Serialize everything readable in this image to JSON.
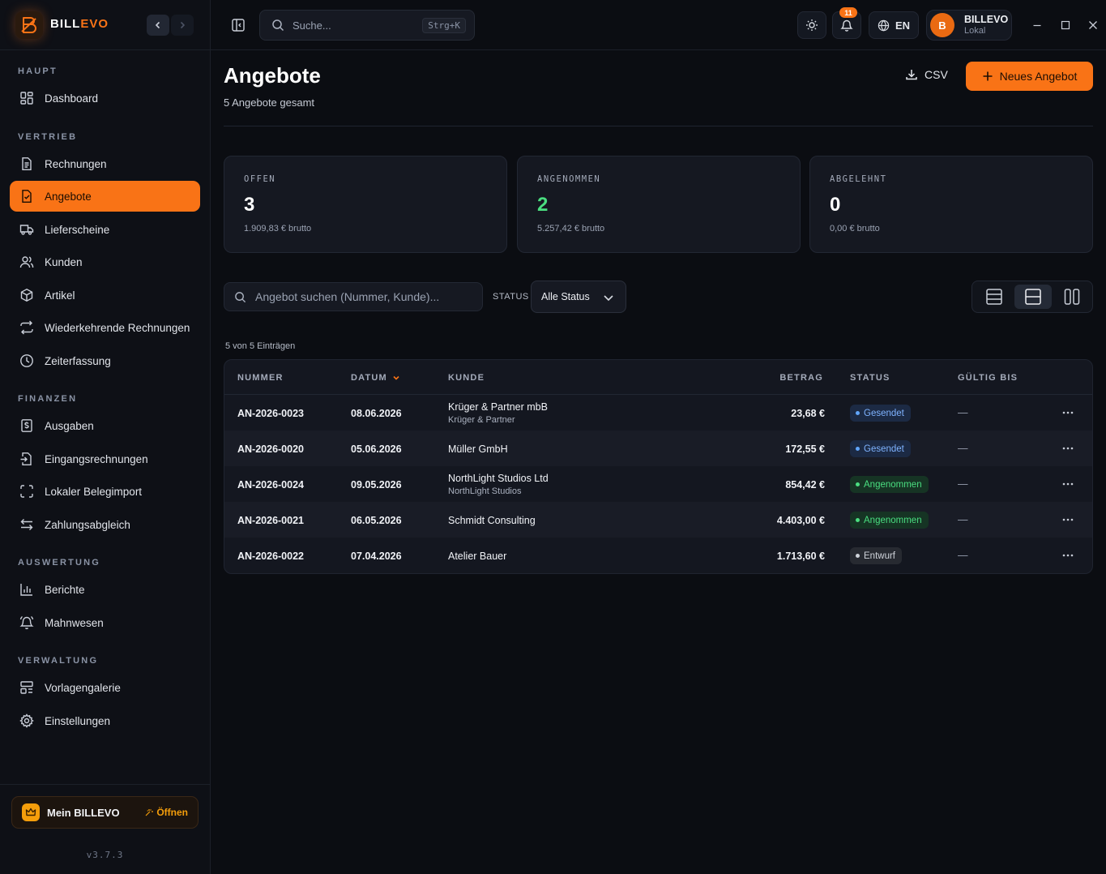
{
  "brand": {
    "part1": "BILL",
    "part2": "EVO",
    "version": "v3.7.3"
  },
  "colors": {
    "accent": "#f97316",
    "sent": "#60a5fa",
    "accepted": "#4ade80",
    "draft": "#cfd3da"
  },
  "sidebar": {
    "sections": {
      "haupt": "HAUPT",
      "vertrieb": "VERTRIEB",
      "finanzen": "FINANZEN",
      "auswertung": "AUSWERTUNG",
      "verwaltung": "VERWALTUNG"
    },
    "items": [
      {
        "label": "Dashboard",
        "icon": "dashboard-icon"
      },
      {
        "label": "Rechnungen",
        "icon": "invoice-icon"
      },
      {
        "label": "Angebote",
        "icon": "quote-icon",
        "active": true
      },
      {
        "label": "Lieferscheine",
        "icon": "truck-icon"
      },
      {
        "label": "Kunden",
        "icon": "users-icon"
      },
      {
        "label": "Artikel",
        "icon": "box-icon"
      },
      {
        "label": "Wiederkehrende Rechnungen",
        "icon": "repeat-icon"
      },
      {
        "label": "Zeiterfassung",
        "icon": "clock-icon"
      },
      {
        "label": "Ausgaben",
        "icon": "receipt-icon"
      },
      {
        "label": "Eingangsrechnungen",
        "icon": "file-import-icon"
      },
      {
        "label": "Lokaler Belegimport",
        "icon": "scan-icon"
      },
      {
        "label": "Zahlungsabgleich",
        "icon": "arrows-swap-icon"
      },
      {
        "label": "Berichte",
        "icon": "bar-chart-icon"
      },
      {
        "label": "Mahnwesen",
        "icon": "bell-ring-icon"
      },
      {
        "label": "Vorlagengalerie",
        "icon": "template-icon"
      },
      {
        "label": "Einstellungen",
        "icon": "gear-icon"
      }
    ],
    "mein": {
      "label": "Mein BILLEVO",
      "open": "Öffnen"
    }
  },
  "topbar": {
    "search_placeholder": "Suche...",
    "shortcut": "Strg+K",
    "notifications": "11",
    "language": "EN",
    "user": {
      "initial": "B",
      "name": "BILLEVO",
      "sub": "Lokal"
    }
  },
  "page": {
    "title": "Angebote",
    "subtitle": "5 Angebote gesamt",
    "csv": "CSV",
    "new_button": "Neues Angebot"
  },
  "stats": [
    {
      "label": "OFFEN",
      "value": "3",
      "sub": "1.909,83 € brutto"
    },
    {
      "label": "ANGENOMMEN",
      "value": "2",
      "sub": "5.257,42 € brutto"
    },
    {
      "label": "ABGELEHNT",
      "value": "0",
      "sub": "0,00 € brutto"
    }
  ],
  "filters": {
    "search_placeholder": "Angebot suchen (Nummer, Kunde)...",
    "status_label": "STATUS",
    "status_value": "Alle Status"
  },
  "entries": "5 von 5 Einträgen",
  "table": {
    "headers": {
      "nummer": "NUMMER",
      "datum": "DATUM",
      "kunde": "KUNDE",
      "betrag": "BETRAG",
      "status": "STATUS",
      "gueltig": "GÜLTIG BIS"
    },
    "rows": [
      {
        "nummer": "AN-2026-0023",
        "datum": "08.06.2026",
        "kunde": "Krüger & Partner mbB",
        "kunde_sub": "Krüger & Partner",
        "betrag": "23,68 €",
        "status": "Gesendet",
        "gueltig": "—"
      },
      {
        "nummer": "AN-2026-0020",
        "datum": "05.06.2026",
        "kunde": "Müller GmbH",
        "kunde_sub": "",
        "betrag": "172,55 €",
        "status": "Gesendet",
        "gueltig": "—"
      },
      {
        "nummer": "AN-2026-0024",
        "datum": "09.05.2026",
        "kunde": "NorthLight Studios Ltd",
        "kunde_sub": "NorthLight Studios",
        "betrag": "854,42 €",
        "status": "Angenommen",
        "gueltig": "—"
      },
      {
        "nummer": "AN-2026-0021",
        "datum": "06.05.2026",
        "kunde": "Schmidt Consulting",
        "kunde_sub": "",
        "betrag": "4.403,00 €",
        "status": "Angenommen",
        "gueltig": "—"
      },
      {
        "nummer": "AN-2026-0022",
        "datum": "07.04.2026",
        "kunde": "Atelier Bauer",
        "kunde_sub": "",
        "betrag": "1.713,60 €",
        "status": "Entwurf",
        "gueltig": "—"
      }
    ]
  }
}
